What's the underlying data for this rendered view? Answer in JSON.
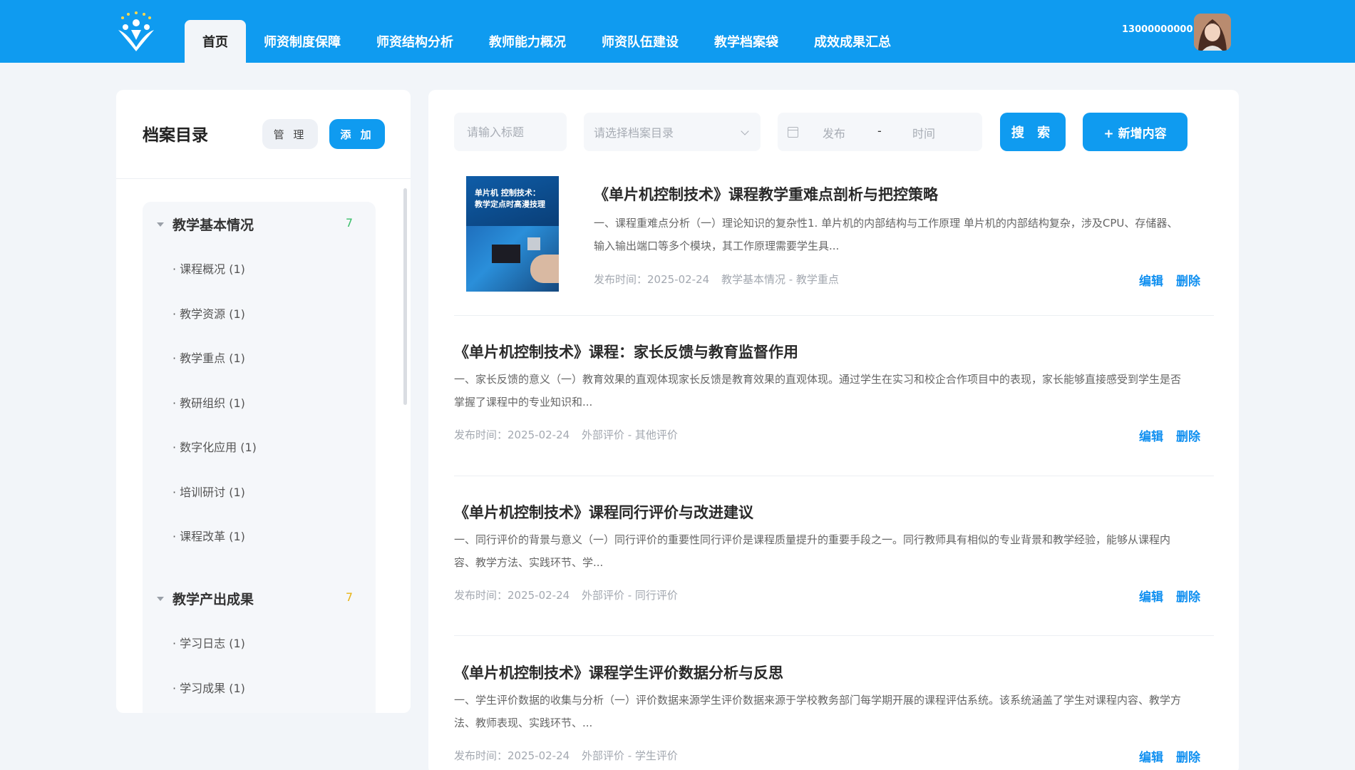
{
  "header": {
    "nav": [
      "首页",
      "师资制度保障",
      "师资结构分析",
      "教师能力概况",
      "师资队伍建设",
      "教学档案袋",
      "成效成果汇总"
    ],
    "active_nav": 0,
    "user_phone": "13000000000"
  },
  "sidebar": {
    "title": "档案目录",
    "manage_label": "管 理",
    "add_label": "添 加",
    "groups": [
      {
        "title": "教学基本情况",
        "count": "7",
        "count_color": "#3bbf6a",
        "items": [
          "· 课程概况 (1)",
          "· 教学资源 (1)",
          "· 教学重点 (1)",
          "· 教研组织 (1)",
          "· 数字化应用 (1)",
          "· 培训研讨 (1)",
          "· 课程改革 (1)"
        ]
      },
      {
        "title": "教学产出成果",
        "count": "7",
        "count_color": "#e8b417",
        "items": [
          "· 学习日志 (1)",
          "· 学习成果 (1)"
        ]
      }
    ]
  },
  "filters": {
    "title_placeholder": "请输入标题",
    "dir_placeholder": "请选择档案目录",
    "date_start": "发布",
    "date_sep": "-",
    "date_end": "时间",
    "search_label": "搜 索",
    "new_label": "+ 新增内容"
  },
  "thumb": {
    "title_line1": "单片机 控制技术：",
    "title_line2": "教学定点时高漫技理"
  },
  "articles": [
    {
      "title": "《单片机控制技术》课程教学重难点剖析与把控策略",
      "body": "一、课程重难点分析（一）理论知识的复杂性1. 单片机的内部结构与工作原理 单片机的内部结构复杂，涉及CPU、存储器、输入输出端口等多个模块，其工作原理需要学生具...",
      "date": "发布时间：2025-02-24",
      "category": "教学基本情况 - 教学重点",
      "edit": "编辑",
      "delete": "删除"
    },
    {
      "title": "《单片机控制技术》课程：家长反馈与教育监督作用",
      "body": "一、家长反馈的意义（一）教育效果的直观体现家长反馈是教育效果的直观体现。通过学生在实习和校企合作项目中的表现，家长能够直接感受到学生是否掌握了课程中的专业知识和...",
      "date": "发布时间：2025-02-24",
      "category": "外部评价 - 其他评价",
      "edit": "编辑",
      "delete": "删除"
    },
    {
      "title": "《单片机控制技术》课程同行评价与改进建议",
      "body": "一、同行评价的背景与意义（一）同行评价的重要性同行评价是课程质量提升的重要手段之一。同行教师具有相似的专业背景和教学经验，能够从课程内容、教学方法、实践环节、学...",
      "date": "发布时间：2025-02-24",
      "category": "外部评价 - 同行评价",
      "edit": "编辑",
      "delete": "删除"
    },
    {
      "title": "《单片机控制技术》课程学生评价数据分析与反思",
      "body": "一、学生评价数据的收集与分析（一）评价数据来源学生评价数据来源于学校教务部门每学期开展的课程评估系统。该系统涵盖了学生对课程内容、教学方法、教师表现、实践环节、...",
      "date": "发布时间：2025-02-24",
      "category": "外部评价 - 学生评价",
      "edit": "编辑",
      "delete": "删除"
    }
  ],
  "colors": {
    "primary": "#0f9bf0",
    "link": "#0f8ff0"
  }
}
